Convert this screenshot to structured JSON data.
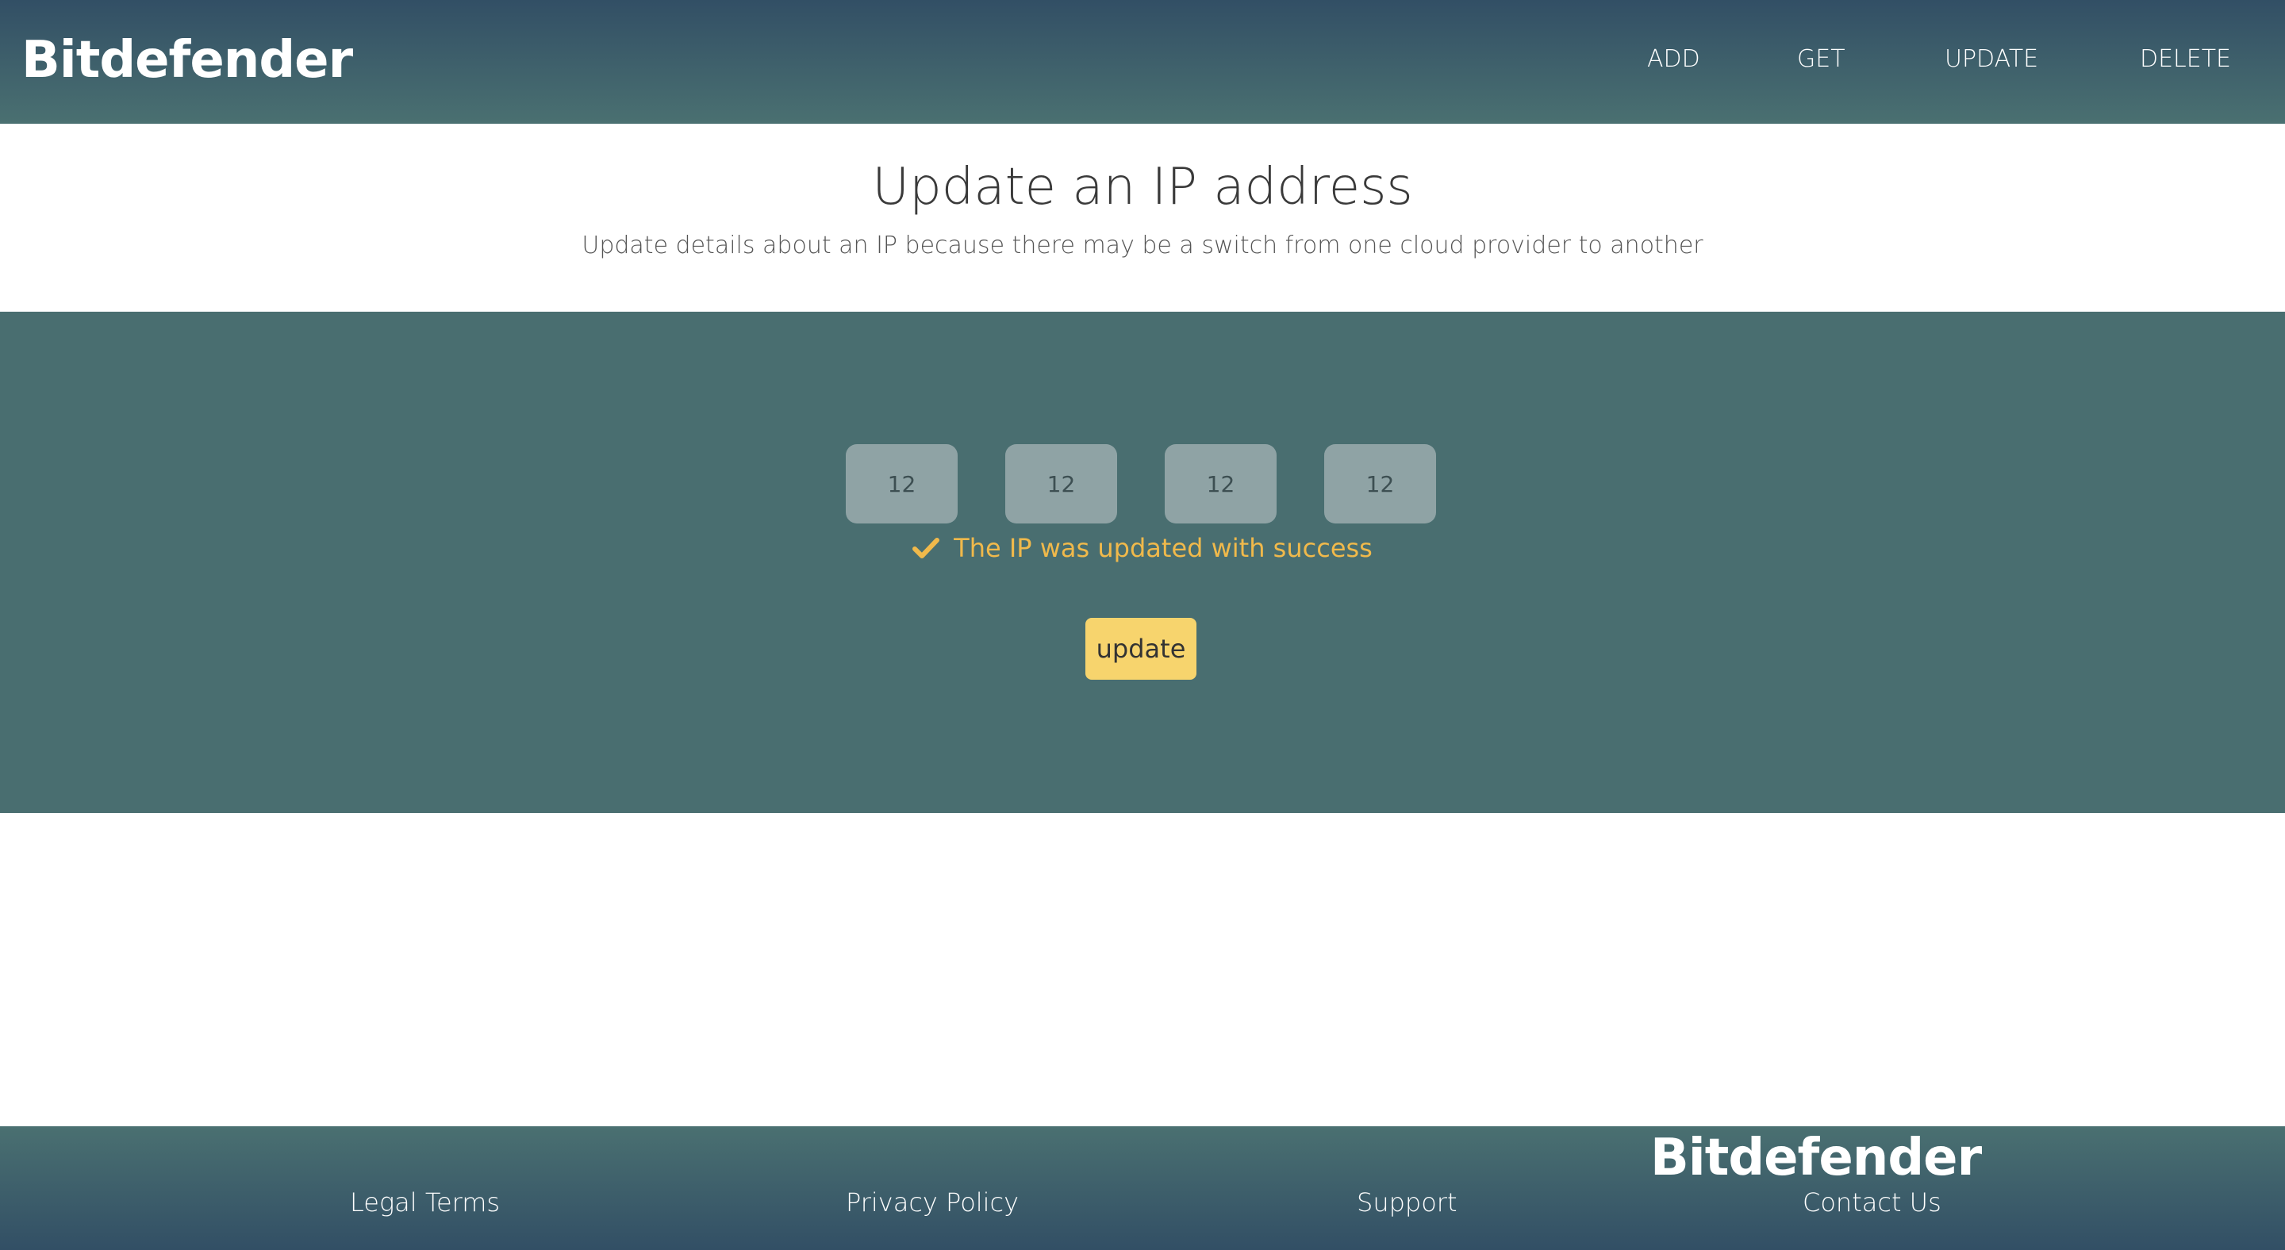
{
  "header": {
    "brand": "Bitdefender",
    "nav": {
      "add": "ADD",
      "get": "GET",
      "update": "UPDATE",
      "delete": "DELETE"
    }
  },
  "hero": {
    "title": "Update an IP address",
    "subtitle": "Update details about an IP because there may be a switch from one cloud provider to another"
  },
  "form": {
    "octets": [
      "12",
      "12",
      "12",
      "12"
    ],
    "success_message": "The IP was updated with success",
    "success_icon": "check-icon",
    "submit_label": "update"
  },
  "footer": {
    "brand": "Bitdefender",
    "links": {
      "legal": "Legal Terms",
      "privacy": "Privacy Policy",
      "support": "Support",
      "contact": "Contact Us"
    }
  },
  "colors": {
    "header_top": "#324f65",
    "panel": "#496e70",
    "input_bg": "#8fa3a5",
    "success": "#f0b94b",
    "button": "#f7d46d"
  }
}
